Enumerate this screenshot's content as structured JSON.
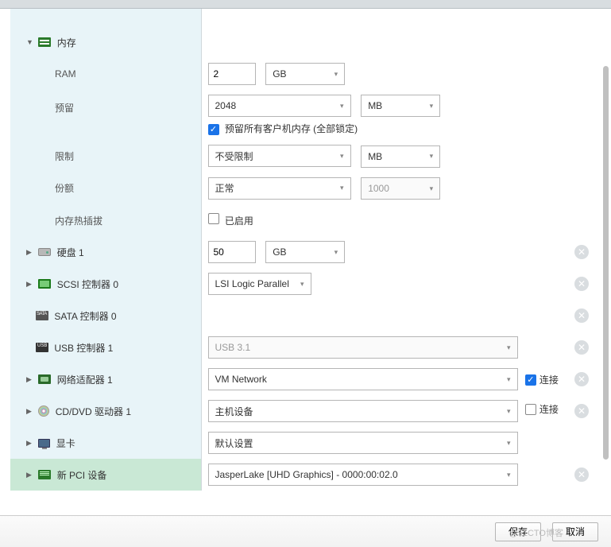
{
  "memory": {
    "header": "内存",
    "ram_label": "RAM",
    "ram_value": "2",
    "ram_unit": "GB",
    "reserve_label": "预留",
    "reserve_value": "2048",
    "reserve_unit": "MB",
    "reserve_checkbox": "预留所有客户机内存 (全部锁定)",
    "limit_label": "限制",
    "limit_value": "不受限制",
    "limit_unit": "MB",
    "shares_label": "份额",
    "shares_value": "正常",
    "shares_num": "1000",
    "hotplug_label": "内存热插拔",
    "hotplug_checkbox": "已启用"
  },
  "rows": {
    "hdd": {
      "label": "硬盘 1",
      "size": "50",
      "unit": "GB"
    },
    "scsi": {
      "label": "SCSI 控制器 0",
      "value": "LSI Logic Parallel"
    },
    "sata": {
      "label": "SATA 控制器 0"
    },
    "usb": {
      "label": "USB 控制器 1",
      "value": "USB 3.1"
    },
    "net": {
      "label": "网络适配器 1",
      "value": "VM Network",
      "connect": "连接"
    },
    "cd": {
      "label": "CD/DVD 驱动器 1",
      "value": "主机设备",
      "connect": "连接"
    },
    "display": {
      "label": "显卡",
      "value": "默认设置"
    },
    "pci": {
      "label": "新 PCI 设备",
      "value": "JasperLake [UHD Graphics] - 0000:00:02.0"
    }
  },
  "footer": {
    "save": "保存",
    "cancel": "取消"
  },
  "watermark": "@51CTO博客"
}
